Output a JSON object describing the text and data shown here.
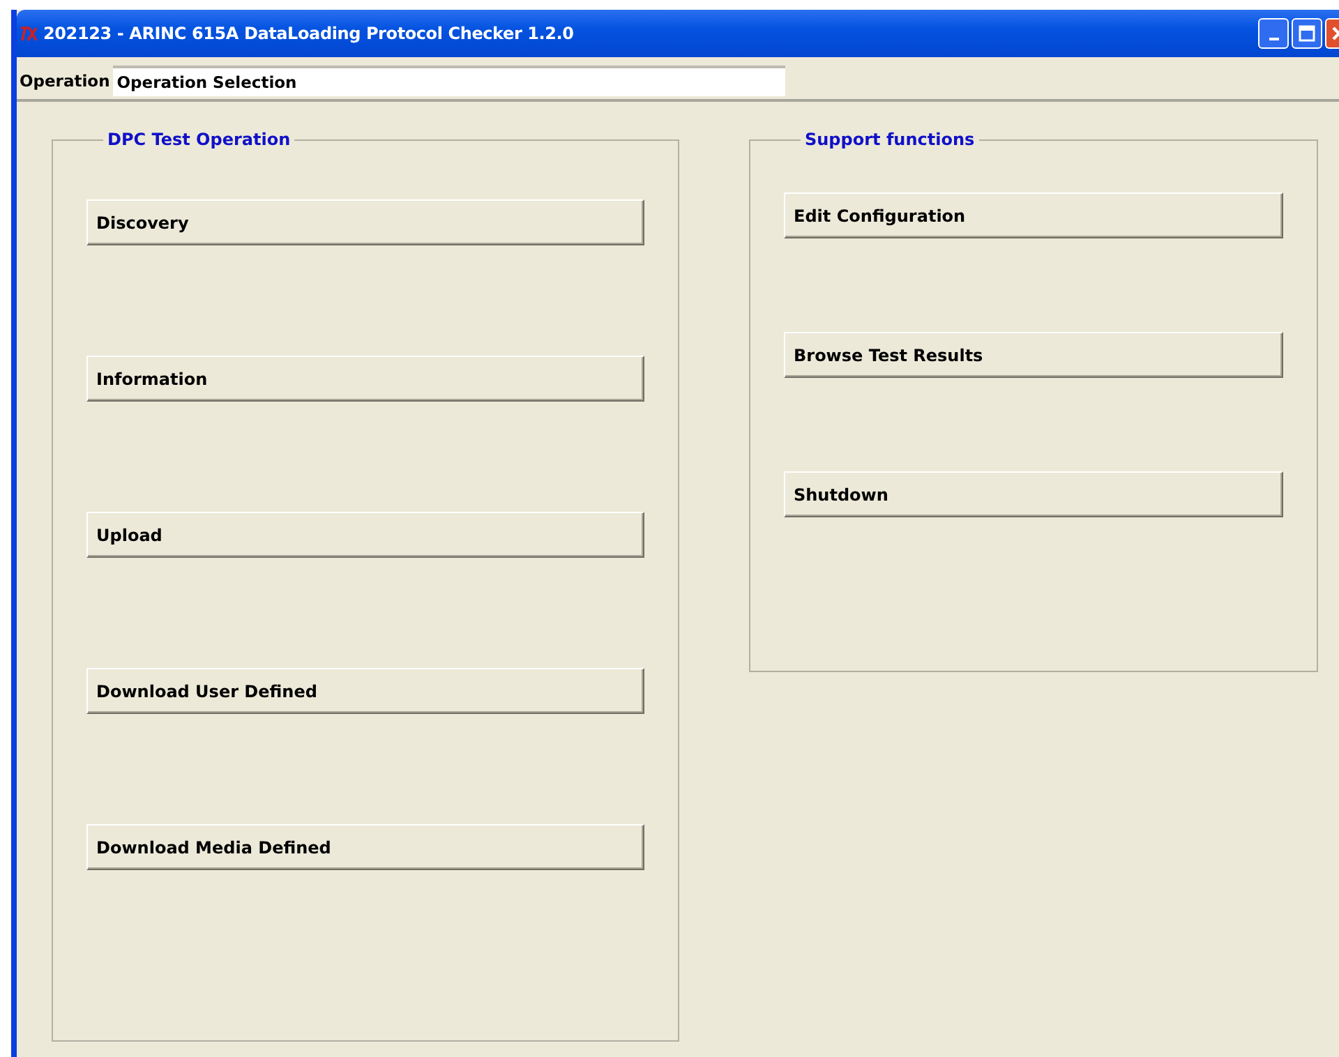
{
  "window": {
    "title": "202123 - ARINC 615A DataLoading Protocol Checker 1.2.0"
  },
  "operation": {
    "label": "Operation",
    "value": "Operation Selection"
  },
  "groups": [
    {
      "title": "DPC Test Operation",
      "buttons": [
        "Discovery",
        "Information",
        "Upload",
        "Download User Defined",
        "Download Media Defined"
      ]
    },
    {
      "title": "Support functions",
      "buttons": [
        "Edit Configuration",
        "Browse Test Results",
        "Shutdown"
      ]
    }
  ]
}
